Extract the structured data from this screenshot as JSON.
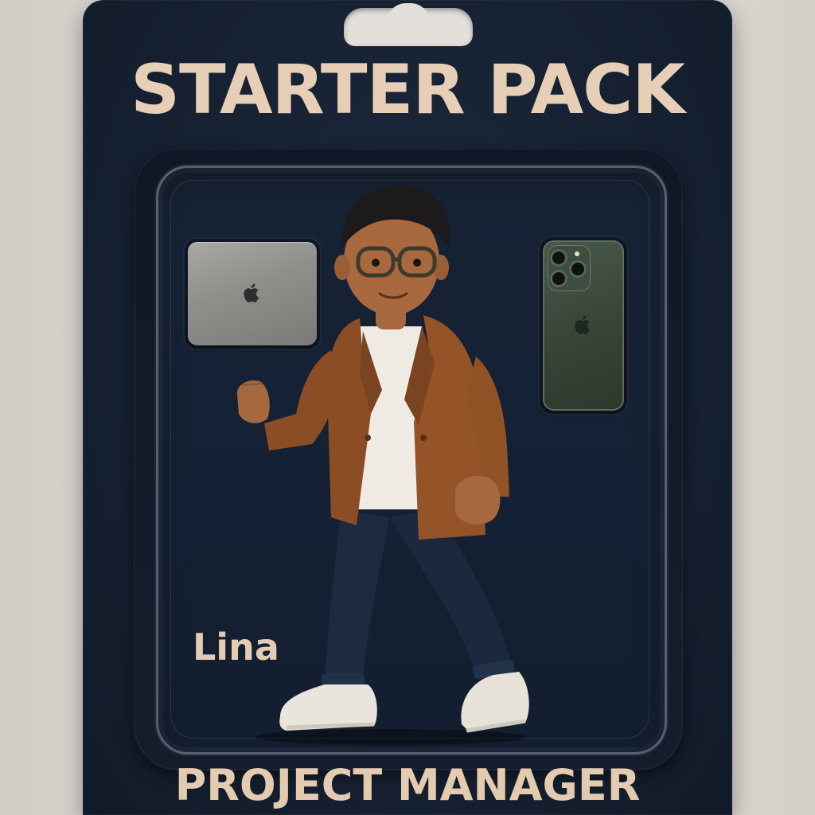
{
  "package": {
    "title": "STARTER PACK",
    "subtitle": "PROJECT MANAGER",
    "name": "Lina"
  },
  "accessories": [
    {
      "item": "laptop-icon"
    },
    {
      "item": "smartphone-icon"
    }
  ],
  "colors": {
    "card": "#162132",
    "text_accent": "#e6cfb6",
    "jacket": "#8b4e24",
    "shirt": "#efebe4",
    "pants": "#1d2a40",
    "shoes": "#e9e5dc",
    "phone": "#3a4a3b",
    "laptop": "#9a9995"
  }
}
